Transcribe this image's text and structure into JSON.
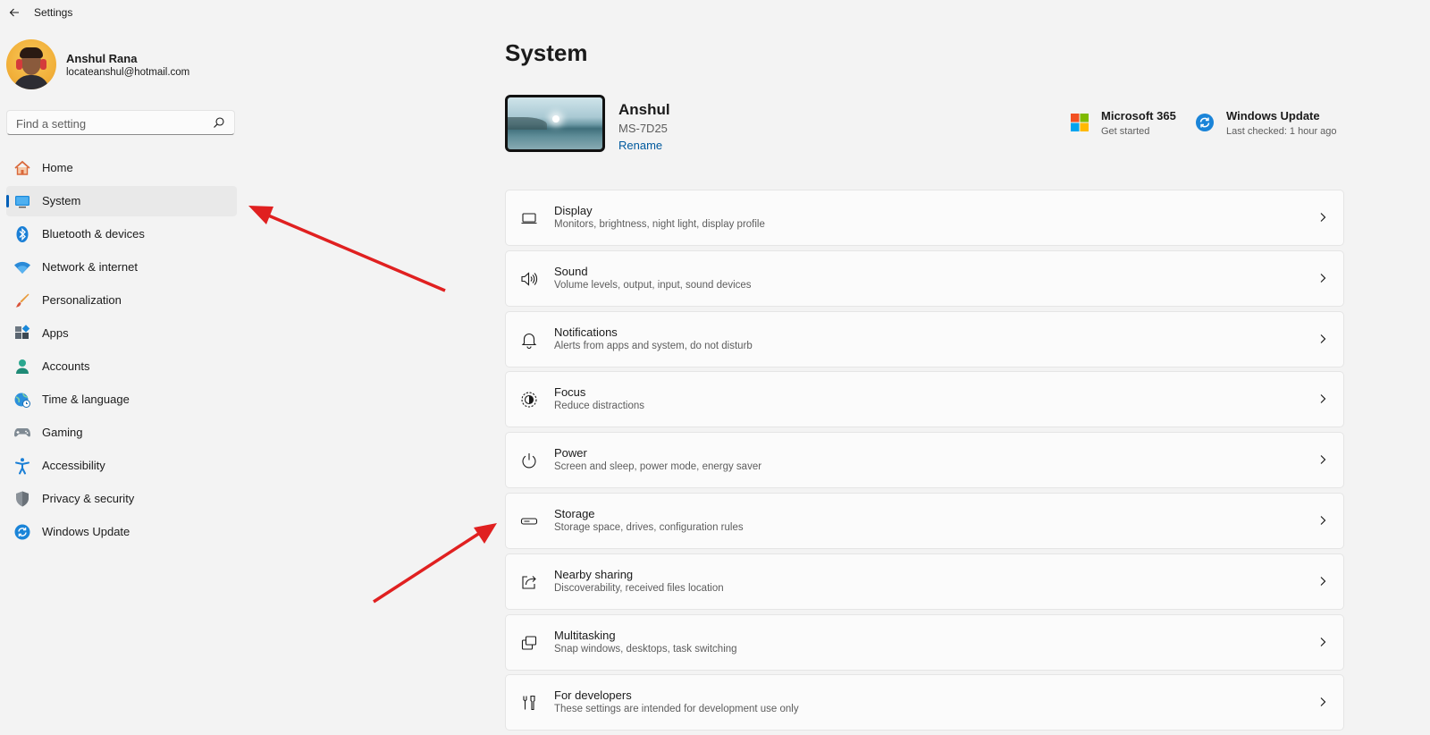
{
  "window": {
    "title": "Settings"
  },
  "profile": {
    "name": "Anshul Rana",
    "email": "locateanshul@hotmail.com"
  },
  "search": {
    "placeholder": "Find a setting"
  },
  "sidebar": {
    "items": [
      {
        "label": "Home",
        "icon": "home-icon"
      },
      {
        "label": "System",
        "icon": "system-icon",
        "selected": true
      },
      {
        "label": "Bluetooth & devices",
        "icon": "bluetooth-icon"
      },
      {
        "label": "Network & internet",
        "icon": "wifi-icon"
      },
      {
        "label": "Personalization",
        "icon": "brush-icon"
      },
      {
        "label": "Apps",
        "icon": "apps-icon"
      },
      {
        "label": "Accounts",
        "icon": "person-icon"
      },
      {
        "label": "Time & language",
        "icon": "globe-clock-icon"
      },
      {
        "label": "Gaming",
        "icon": "gamepad-icon"
      },
      {
        "label": "Accessibility",
        "icon": "accessibility-icon"
      },
      {
        "label": "Privacy & security",
        "icon": "shield-icon"
      },
      {
        "label": "Windows Update",
        "icon": "refresh-icon"
      }
    ]
  },
  "main": {
    "title": "System",
    "device": {
      "name": "Anshul",
      "model": "MS-7D25",
      "rename": "Rename"
    },
    "quick_links": [
      {
        "title": "Microsoft 365",
        "subtitle": "Get started",
        "icon": "microsoft-logo-icon"
      },
      {
        "title": "Windows Update",
        "subtitle": "Last checked: 1 hour ago",
        "icon": "windows-update-icon"
      }
    ],
    "cards": [
      {
        "title": "Display",
        "subtitle": "Monitors, brightness, night light, display profile",
        "icon": "monitor-icon"
      },
      {
        "title": "Sound",
        "subtitle": "Volume levels, output, input, sound devices",
        "icon": "speaker-icon"
      },
      {
        "title": "Notifications",
        "subtitle": "Alerts from apps and system, do not disturb",
        "icon": "bell-icon"
      },
      {
        "title": "Focus",
        "subtitle": "Reduce distractions",
        "icon": "focus-icon"
      },
      {
        "title": "Power",
        "subtitle": "Screen and sleep, power mode, energy saver",
        "icon": "power-icon"
      },
      {
        "title": "Storage",
        "subtitle": "Storage space, drives, configuration rules",
        "icon": "storage-icon"
      },
      {
        "title": "Nearby sharing",
        "subtitle": "Discoverability, received files location",
        "icon": "share-icon"
      },
      {
        "title": "Multitasking",
        "subtitle": "Snap windows, desktops, task switching",
        "icon": "multitask-icon"
      },
      {
        "title": "For developers",
        "subtitle": "These settings are intended for development use only",
        "icon": "developer-tools-icon"
      }
    ]
  },
  "colors": {
    "accent": "#005fb8",
    "annotation_arrow": "#e02020",
    "background": "#f3f3f3"
  }
}
